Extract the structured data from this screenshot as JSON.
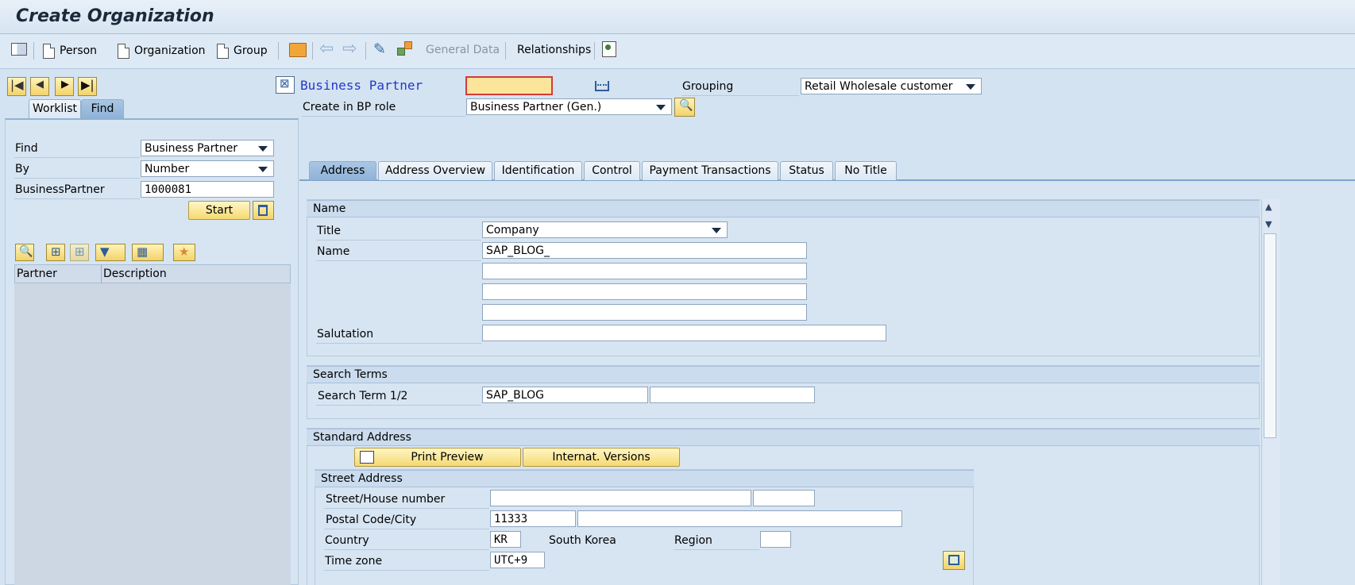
{
  "window": {
    "title": "Create Organization"
  },
  "toolbar": {
    "person": "Person",
    "organization": "Organization",
    "group": "Group",
    "general_data": "General Data",
    "relationships": "Relationships"
  },
  "left": {
    "tabs": [
      "Worklist",
      "Find"
    ],
    "find_label": "Find",
    "find_value": "Business Partner",
    "by_label": "By",
    "by_value": "Number",
    "bp_label": "BusinessPartner",
    "bp_value": "1000081",
    "start": "Start",
    "columns": [
      "Partner",
      "Description"
    ]
  },
  "header": {
    "bp_label": "Business Partner",
    "bp_value": "",
    "grouping_label": "Grouping",
    "grouping_value": "Retail Wholesale customer",
    "role_label": "Create in BP role",
    "role_value": "Business Partner (Gen.)"
  },
  "tabs": [
    "Address",
    "Address Overview",
    "Identification",
    "Control",
    "Payment Transactions",
    "Status",
    "No Title"
  ],
  "name_section": {
    "header": "Name",
    "title_label": "Title",
    "title_value": "Company",
    "name_label": "Name",
    "name_values": [
      "SAP_BLOG_",
      "",
      "",
      ""
    ],
    "salutation_label": "Salutation",
    "salutation_value": ""
  },
  "search_section": {
    "header": "Search Terms",
    "label": "Search Term 1/2",
    "term1": "SAP_BLOG",
    "term2": ""
  },
  "address_section": {
    "header": "Standard Address",
    "print_preview": "Print Preview",
    "internat_versions": "Internat. Versions",
    "street_header": "Street Address",
    "street_label": "Street/House number",
    "street_value": "",
    "house_value": "",
    "postal_label": "Postal Code/City",
    "postal_value": "11333",
    "city_value": "",
    "country_label": "Country",
    "country_value": "KR",
    "country_name": "South Korea",
    "region_label": "Region",
    "region_value": "",
    "timezone_label": "Time zone",
    "timezone_value": "UTC+9"
  }
}
